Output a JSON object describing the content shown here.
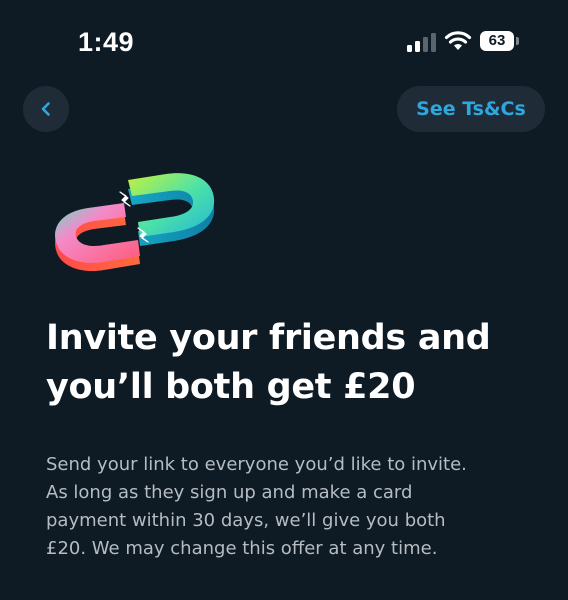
{
  "status_bar": {
    "time": "1:49",
    "signal_icon": "cellular-signal-icon",
    "wifi_icon": "wifi-icon",
    "battery_level": "63"
  },
  "nav": {
    "back_icon": "chevron-left-icon",
    "terms_button_label": "See Ts&Cs"
  },
  "colors": {
    "background": "#0e1a24",
    "button_bg": "#1f2c38",
    "accent": "#2ea7de",
    "body_text": "#b5bcc2"
  },
  "illustration": {
    "icon": "magnet-link-icon"
  },
  "content": {
    "headline_line1": "Invite your friends and",
    "headline_line2": "you’ll both get £20",
    "body_line1": "Send your link to everyone you’d like to invite.",
    "body_line2": "As long as they sign up and make a card",
    "body_line3": "payment within 30 days, we’ll give you both",
    "body_line4": "£20. We may change this offer at any time."
  }
}
